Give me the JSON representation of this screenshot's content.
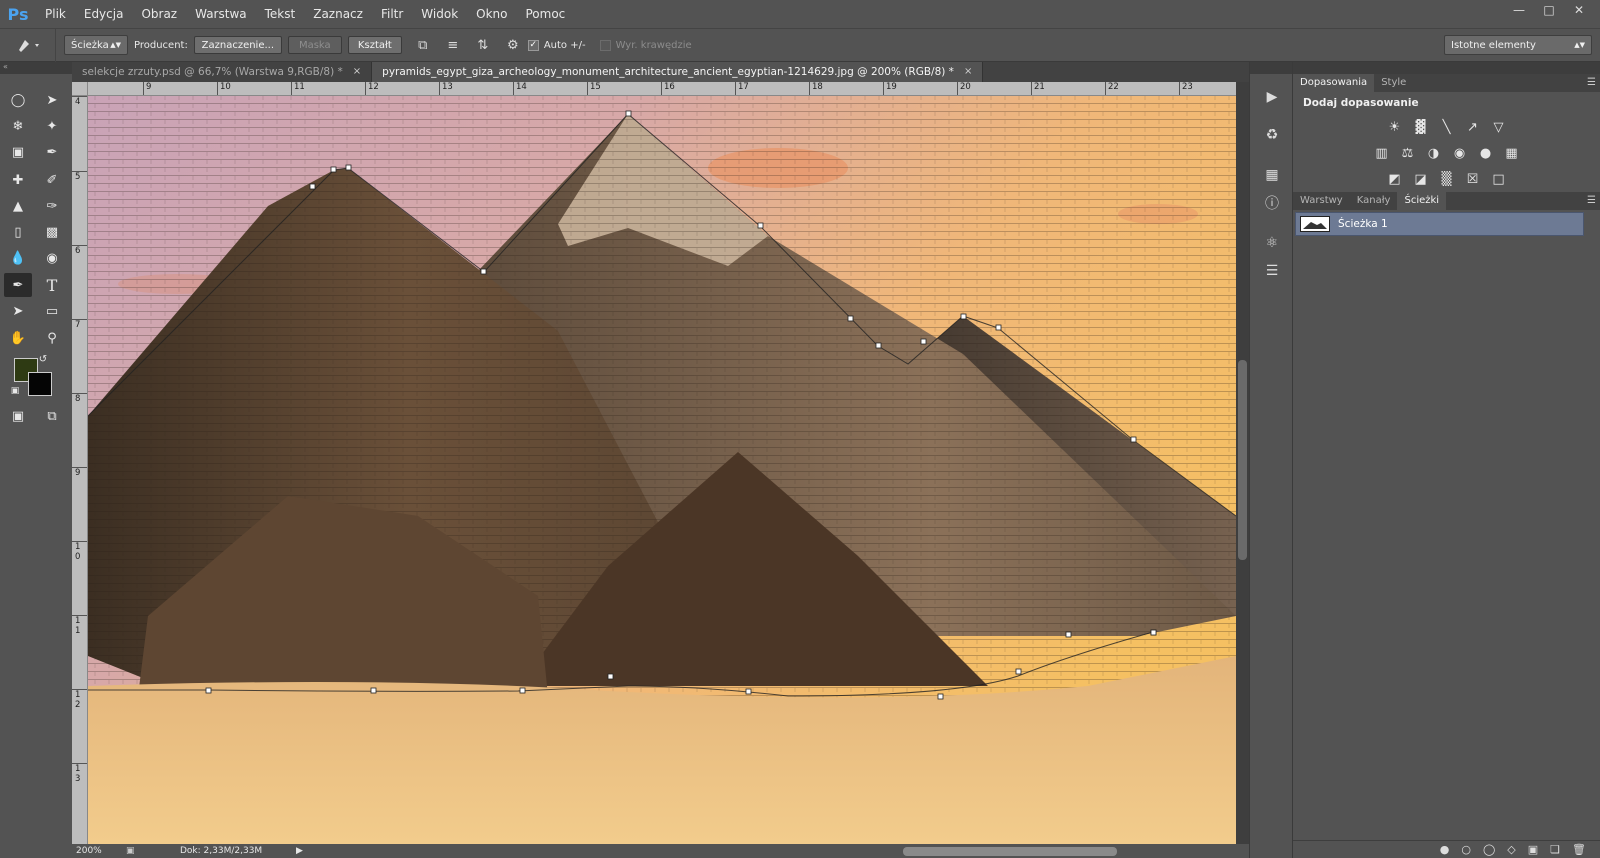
{
  "app": {
    "logo": "Ps"
  },
  "menu": [
    "Plik",
    "Edycja",
    "Obraz",
    "Warstwa",
    "Tekst",
    "Zaznacz",
    "Filtr",
    "Widok",
    "Okno",
    "Pomoc"
  ],
  "window_controls": {
    "minimize": "—",
    "restore": "□",
    "close": "✕"
  },
  "options": {
    "mode_select": "Ścieżka",
    "producer_label": "Producent:",
    "selection_btn": "Zaznaczenie...",
    "mask_btn": "Maska",
    "shape_btn": "Kształt",
    "auto_label": "Auto +/-",
    "edges_label": "Wyr. krawędzie",
    "workspace": "Istotne elementy"
  },
  "tabs": [
    {
      "label": "selekcje zrzuty.psd @ 66,7% (Warstwa 9,RGB/8) *",
      "close": "×"
    },
    {
      "label": "pyramids_egypt_giza_archeology_monument_architecture_ancient_egyptian-1214629.jpg @ 200% (RGB/8) *",
      "close": "×"
    }
  ],
  "ruler": {
    "top": [
      "9",
      "10",
      "11",
      "12",
      "13",
      "14",
      "15",
      "16",
      "17",
      "18",
      "19",
      "20",
      "21",
      "22",
      "23"
    ],
    "left": [
      "4",
      "5",
      "6",
      "7",
      "8",
      "9",
      "1 0",
      "1 1",
      "1 2",
      "1 3"
    ]
  },
  "status": {
    "zoom": "200%",
    "doc": "Dok: 2,33M/2,33M"
  },
  "panels": {
    "top_tabs": [
      "Dopasowania",
      "Style"
    ],
    "adj_title": "Dodaj dopasowanie",
    "bottom_tabs": [
      "Warstwy",
      "Kanały",
      "Ścieżki"
    ],
    "path_name": "Ścieżka 1"
  },
  "colors": {
    "foreground": "#2e3a13",
    "background": "#050505",
    "accent": "#6d7a94"
  },
  "icons": {
    "adj_row1": [
      "☀",
      "▓",
      "╲",
      "↗",
      "▽"
    ],
    "adj_row2": [
      "▥",
      "⚖",
      "◑",
      "◉",
      "●",
      "▦"
    ],
    "adj_row3": [
      "◩",
      "◪",
      "▒",
      "☒",
      "□"
    ]
  }
}
